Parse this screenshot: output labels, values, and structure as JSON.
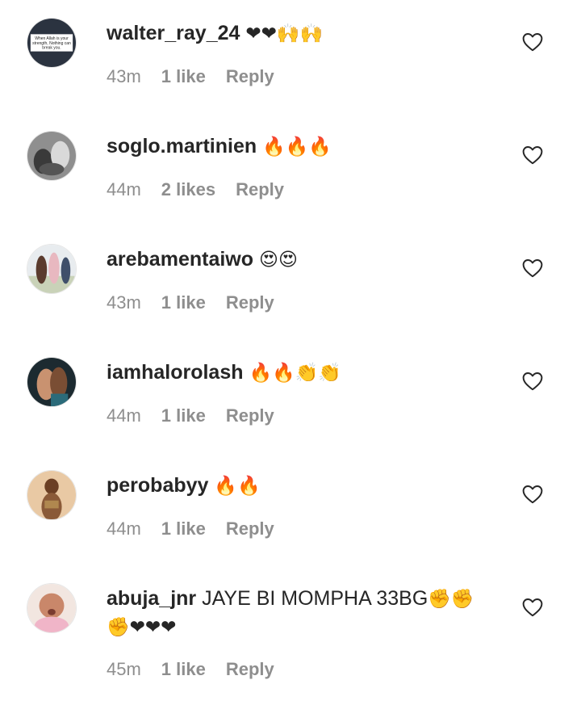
{
  "comments": [
    {
      "username": "walter_ray_24",
      "text": "",
      "emoji": "❤❤🙌🙌",
      "time": "43m",
      "likes": "1 like",
      "reply": "Reply",
      "avatar_text": "When Allah is your strength, Nothing can break you."
    },
    {
      "username": "soglo.martinien",
      "text": "",
      "emoji": "🔥🔥🔥",
      "time": "44m",
      "likes": "2 likes",
      "reply": "Reply"
    },
    {
      "username": "arebamentaiwo",
      "text": "",
      "emoji": "😍😍",
      "time": "43m",
      "likes": "1 like",
      "reply": "Reply"
    },
    {
      "username": "iamhalorolash",
      "text": "",
      "emoji": "🔥🔥👏👏",
      "time": "44m",
      "likes": "1 like",
      "reply": "Reply"
    },
    {
      "username": "perobabyy",
      "text": "",
      "emoji": "🔥🔥",
      "time": "44m",
      "likes": "1 like",
      "reply": "Reply"
    },
    {
      "username": "abuja_jnr",
      "text": "JAYE BI MOMPHA 33BG",
      "emoji": "✊✊✊❤❤❤",
      "time": "45m",
      "likes": "1 like",
      "reply": "Reply"
    }
  ],
  "colors": {
    "text": "#262626",
    "meta": "#8e8e8e",
    "heart_stroke": "#262626"
  },
  "icons": {
    "like": "heart-outline-icon"
  }
}
